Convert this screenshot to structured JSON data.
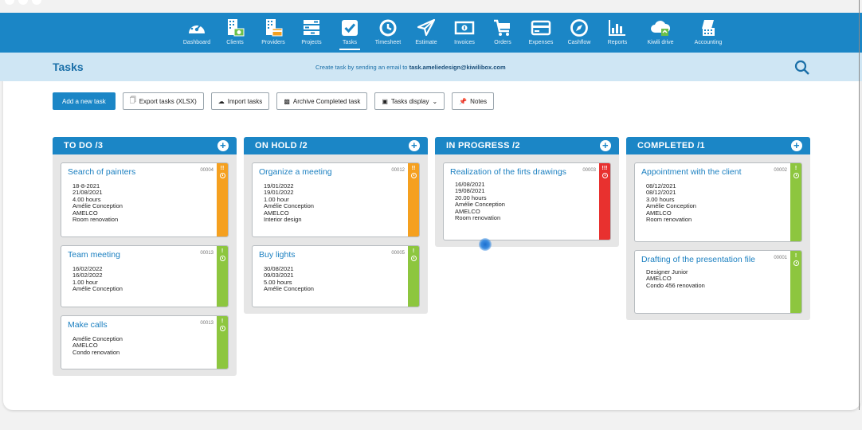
{
  "nav": {
    "items": [
      {
        "label": "Dashboard",
        "icon": "dashboard-icon"
      },
      {
        "label": "Clients",
        "icon": "clients-icon"
      },
      {
        "label": "Providers",
        "icon": "providers-icon"
      },
      {
        "label": "Projects",
        "icon": "projects-icon"
      },
      {
        "label": "Tasks",
        "icon": "tasks-icon",
        "active": true
      },
      {
        "label": "Timesheet",
        "icon": "clock-icon"
      },
      {
        "label": "Estimate",
        "icon": "paper-plane-icon"
      },
      {
        "label": "Invoices",
        "icon": "banknote-icon"
      },
      {
        "label": "Orders",
        "icon": "cart-icon"
      },
      {
        "label": "Expenses",
        "icon": "card-icon"
      },
      {
        "label": "Cashflow",
        "icon": "compass-icon"
      },
      {
        "label": "Reports",
        "icon": "bar-chart-icon"
      },
      {
        "label": "Kiwili drive",
        "icon": "cloud-icon"
      },
      {
        "label": "Accounting",
        "icon": "accounting-icon"
      }
    ]
  },
  "header": {
    "title": "Tasks",
    "hint_prefix": "Create task by sending an email to",
    "hint_email": "task.ameliedesign@kiwilibox.com"
  },
  "toolbar": {
    "add": "Add a new task",
    "export": "Export tasks (XLSX)",
    "import": "Import tasks",
    "archive": "Archive Completed task",
    "display": "Tasks display",
    "notes": "Notes"
  },
  "colors": {
    "brand": "#1b86c6",
    "orange": "#f5a01f",
    "green": "#8dc63f",
    "red": "#e8312f"
  },
  "columns": [
    {
      "title": "TO DO /3",
      "cards": [
        {
          "title": "Search of painters",
          "number": "00004",
          "priority": "!!",
          "color": "#f5a01f",
          "lines": [
            "18-8-2021",
            "21/08/2021",
            "4.00 hours",
            "Amélie Conception",
            "AMELCO",
            "Room renovation"
          ]
        },
        {
          "title": "Team meeting",
          "number": "00013",
          "priority": "!",
          "color": "#8dc63f",
          "lines": [
            "16/02/2022",
            "16/02/2022",
            "1.00 hour",
            "Amélie Conception"
          ]
        },
        {
          "title": "Make calls",
          "number": "00013",
          "priority": "!",
          "color": "#8dc63f",
          "lines": [
            "Amélie Conception",
            "AMELCO",
            "Condo renovation"
          ]
        }
      ]
    },
    {
      "title": "ON HOLD /2",
      "cards": [
        {
          "title": "Organize a meeting",
          "number": "00012",
          "priority": "!!",
          "color": "#f5a01f",
          "lines": [
            "19/01/2022",
            "19/01/2022",
            "1.00 hour",
            "Amélie Conception",
            "AMELCO",
            "Interior design"
          ]
        },
        {
          "title": "Buy lights",
          "number": "00005",
          "priority": "!",
          "color": "#8dc63f",
          "lines": [
            "30/08/2021",
            "09/03/2021",
            "5.00 hours",
            "Amélie Conception"
          ]
        }
      ]
    },
    {
      "title": "IN PROGRESS /2",
      "cards": [
        {
          "title": "Realization of the firts drawings",
          "number": "00003",
          "priority": "!!!",
          "color": "#e8312f",
          "lines": [
            "16/08/2021",
            "19/08/2021",
            "20.00 hours",
            "Amélie Conception",
            "AMELCO",
            "Room renovation"
          ]
        }
      ]
    },
    {
      "title": "COMPLETED /1",
      "cards": [
        {
          "title": "Appointment with the client",
          "number": "00002",
          "priority": "!",
          "color": "#8dc63f",
          "lines": [
            "08/12/2021",
            "08/12/2021",
            "3.00 hours",
            "Amélie Conception",
            "AMELCO",
            "Room renovation"
          ]
        },
        {
          "title": "Drafting of the presentation file",
          "number": "00001",
          "priority": "!",
          "color": "#8dc63f",
          "lines": [
            "Designer Junior",
            "AMELCO",
            "Condo 456 renovation"
          ]
        }
      ]
    }
  ]
}
